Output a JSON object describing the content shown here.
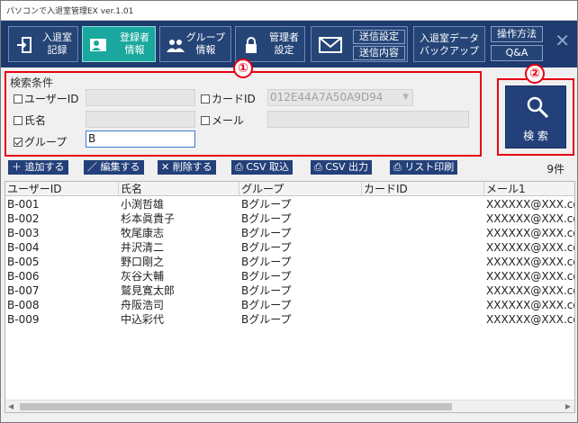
{
  "window": {
    "title": "パソコンで入退室管理EX ver.1.01"
  },
  "toolbar": {
    "entry_record": "入退室\n記録",
    "registrant_info": "登録者\n情報",
    "group_info": "グループ\n情報",
    "admin_settings": "管理者\n設定",
    "send_settings": "送信設定",
    "send_content": "送信内容",
    "data_backup": "入退室データ\nバックアップ",
    "how_to": "操作方法",
    "qa": "Q&A",
    "close": "✕"
  },
  "search": {
    "section_title": "検索条件",
    "user_id_label": "ユーザーID",
    "user_id_value": "",
    "card_id_label": "カードID",
    "card_id_value": "012E44A7A50A9D94",
    "name_label": "氏名",
    "name_value": "",
    "mail_label": "メール",
    "mail_value": "",
    "group_label": "グループ",
    "group_value": "B",
    "search_button": "検 索"
  },
  "annotations": {
    "badge1": "①",
    "badge2": "②"
  },
  "actions": {
    "add": "追加する",
    "edit": "編集する",
    "delete": "削除する",
    "csv_import": "CSV 取込",
    "csv_export": "CSV 出力",
    "print": "リスト印刷",
    "count": "9件"
  },
  "table": {
    "columns": [
      "ユーザーID",
      "氏名",
      "グループ",
      "カードID",
      "メール1"
    ],
    "rows": [
      [
        "B-001",
        "小渕哲雄",
        "Bグループ",
        "",
        "XXXXXX@XXX.co"
      ],
      [
        "B-002",
        "杉本眞貴子",
        "Bグループ",
        "",
        "XXXXXX@XXX.co"
      ],
      [
        "B-003",
        "牧尾康志",
        "Bグループ",
        "",
        "XXXXXX@XXX.co"
      ],
      [
        "B-004",
        "井沢清二",
        "Bグループ",
        "",
        "XXXXXX@XXX.co"
      ],
      [
        "B-005",
        "野口剛之",
        "Bグループ",
        "",
        "XXXXXX@XXX.co"
      ],
      [
        "B-006",
        "灰谷大輔",
        "Bグループ",
        "",
        "XXXXXX@XXX.co"
      ],
      [
        "B-007",
        "鷲見寛太郎",
        "Bグループ",
        "",
        "XXXXXX@XXX.co"
      ],
      [
        "B-008",
        "舟阪浩司",
        "Bグループ",
        "",
        "XXXXXX@XXX.co"
      ],
      [
        "B-009",
        "中込彩代",
        "Bグループ",
        "",
        "XXXXXX@XXX.co"
      ]
    ]
  },
  "colors": {
    "toolbar": "#1e3a6e",
    "active": "#1aa89e",
    "highlight": "#e60012",
    "button": "#23407a"
  }
}
